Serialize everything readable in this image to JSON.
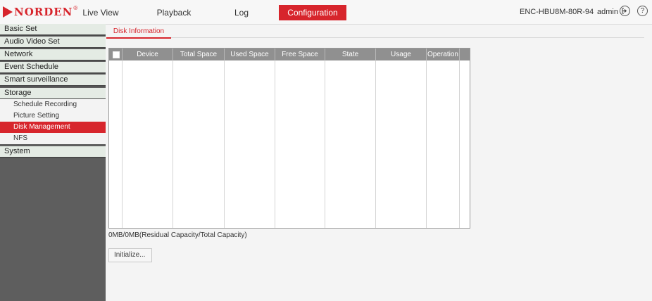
{
  "header": {
    "logo_text": "NORDEN",
    "logo_mark": "®",
    "tabs": [
      {
        "label": "Live View"
      },
      {
        "label": "Playback"
      },
      {
        "label": "Log"
      },
      {
        "label": "Configuration",
        "active": true
      }
    ],
    "device_id": "ENC-HBU8M-80R-94",
    "user": "admin",
    "icons": [
      "logout-icon",
      "help-icon"
    ]
  },
  "sidebar": {
    "items": [
      {
        "label": "Basic Set"
      },
      {
        "label": "Audio Video Set"
      },
      {
        "label": "Network"
      },
      {
        "label": "Event Schedule"
      },
      {
        "label": "Smart surveillance"
      },
      {
        "label": "Storage"
      },
      {
        "label": "System"
      }
    ],
    "storage_sub": [
      {
        "label": "Schedule Recording"
      },
      {
        "label": "Picture Setting"
      },
      {
        "label": "Disk Management",
        "active": true
      },
      {
        "label": "NFS"
      }
    ]
  },
  "main": {
    "tab": "Disk Information",
    "columns": [
      "Device",
      "Total Space",
      "Used Space",
      "Free Space",
      "State",
      "Usage",
      "Operation"
    ],
    "rows": [],
    "capacity": "0MB/0MB(Residual Capacity/Total Capacity)",
    "init_button": "Initialize..."
  },
  "colors": {
    "accent": "#d7252c",
    "sidebar_bg": "#5e5e5e",
    "header_bg": "#909090"
  }
}
